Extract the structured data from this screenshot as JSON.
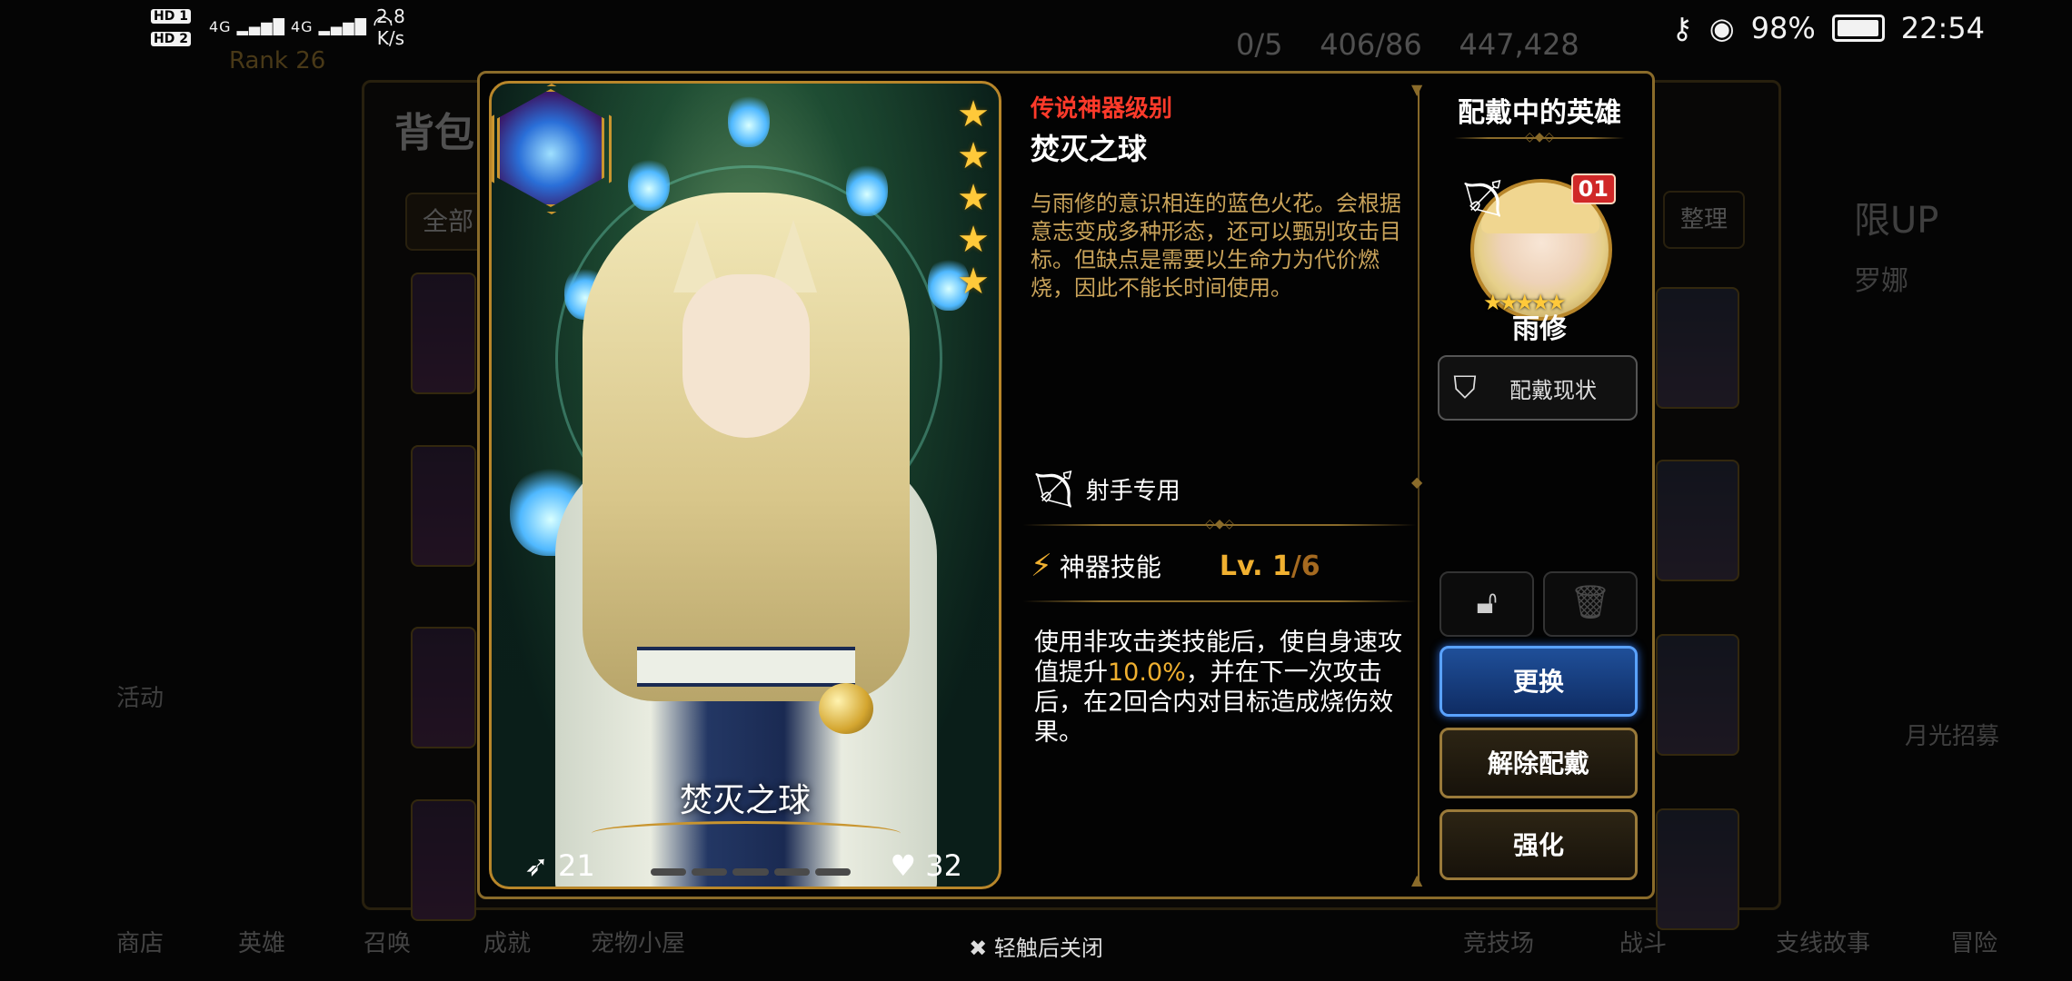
{
  "status_bar": {
    "sim1": "HD 1",
    "sim2": "HD 2",
    "net1": "4G",
    "net2": "4G",
    "speed_value": "2.8",
    "speed_unit": "K/s",
    "battery": "98%",
    "battery_level": 0.98,
    "time": "22:54"
  },
  "background": {
    "rank": "Rank 26",
    "panel_title": "背包",
    "tab_all": "全部",
    "sort_button": "整理",
    "currency_a": "0/5",
    "currency_b": "406/86",
    "currency_c": "447,428",
    "side_label": "活动",
    "right_label_1": "限UP",
    "right_label_2": "罗娜",
    "right_label_3": "月光招募",
    "nav": [
      "商店",
      "英雄",
      "召唤",
      "成就",
      "宠物小屋",
      "竞技场",
      "战斗",
      "支线故事",
      "冒险"
    ]
  },
  "artifact": {
    "grade": "传说神器级别",
    "name": "焚灭之球",
    "description": "与雨修的意识相连的蓝色火花。会根据意志变成多种形态，还可以甄别攻击目标。但缺点是需要以生命力为代价燃烧，因此不能长时间使用。",
    "stars": 5,
    "attack": "21",
    "health": "32",
    "class_restriction": "射手专用",
    "skill_label": "神器技能",
    "skill_level": "Lv. 1",
    "skill_level_max": "/6",
    "skill_desc_part1": "使用非攻击类技能后，使自身速攻值提升",
    "skill_desc_highlight": "10.0%",
    "skill_desc_part2": "，并在下一次攻击后，在2回合内对目标造成烧伤效果。"
  },
  "equipped_hero": {
    "section_title": "配戴中的英雄",
    "level": "01",
    "name": "雨修",
    "stars": 5,
    "status_button": "配戴现状"
  },
  "actions": {
    "change": "更换",
    "unequip": "解除配戴",
    "enhance": "强化"
  },
  "footer": {
    "close_hint": "轻触后关闭"
  },
  "colors": {
    "grade_red": "#ff3a2a",
    "gold": "#f0b030",
    "frame_gold": "#8a6b2a",
    "button_blue": "#1f4f99"
  }
}
